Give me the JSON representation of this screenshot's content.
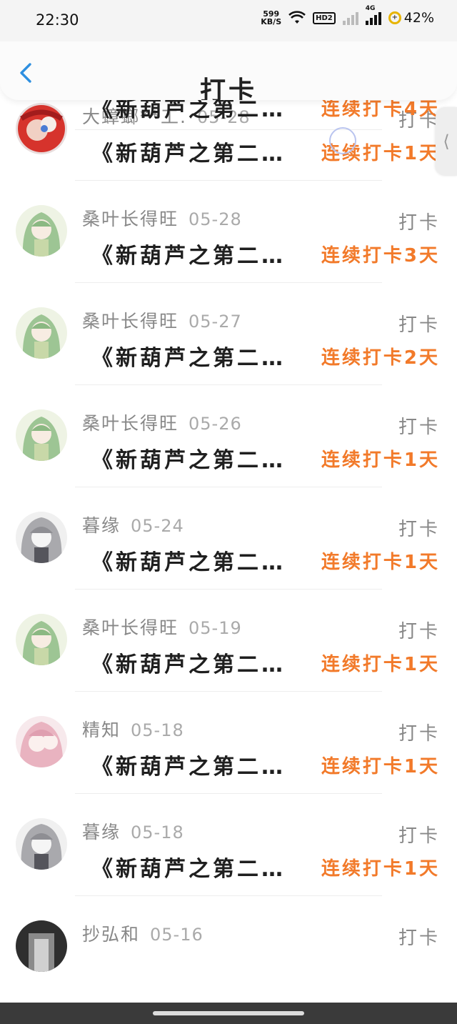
{
  "status_bar": {
    "time": "22:30",
    "net_speed_value": "599",
    "net_speed_unit": "KB/S",
    "hd_label": "HD2",
    "network_label": "4G",
    "battery": "42%",
    "icons": [
      "wifi-icon",
      "signal-icon",
      "battery-icon"
    ]
  },
  "header": {
    "title": "打卡",
    "back_icon": "chevron-left-icon"
  },
  "partial_row": {
    "book": "《新葫芦之第二…",
    "streak": "连续打卡4天"
  },
  "rows": [
    {
      "name": "大蟑螂**工.",
      "date": "05-28",
      "action": "打卡",
      "book": "《新葫芦之第二…",
      "streak": "连续打卡1天"
    },
    {
      "name": "桑叶长得旺",
      "date": "05-28",
      "action": "打卡",
      "book": "《新葫芦之第二…",
      "streak": "连续打卡3天"
    },
    {
      "name": "桑叶长得旺",
      "date": "05-27",
      "action": "打卡",
      "book": "《新葫芦之第二…",
      "streak": "连续打卡2天"
    },
    {
      "name": "桑叶长得旺",
      "date": "05-26",
      "action": "打卡",
      "book": "《新葫芦之第二…",
      "streak": "连续打卡1天"
    },
    {
      "name": "暮缘",
      "date": "05-24",
      "action": "打卡",
      "book": "《新葫芦之第二…",
      "streak": "连续打卡1天"
    },
    {
      "name": "桑叶长得旺",
      "date": "05-19",
      "action": "打卡",
      "book": "《新葫芦之第二…",
      "streak": "连续打卡1天"
    },
    {
      "name": "精知",
      "date": "05-18",
      "action": "打卡",
      "book": "《新葫芦之第二…",
      "streak": "连续打卡1天"
    },
    {
      "name": "暮缘",
      "date": "05-18",
      "action": "打卡",
      "book": "《新葫芦之第二…",
      "streak": "连续打卡1天"
    },
    {
      "name": "抄弘和",
      "date": "05-16",
      "action": "打卡",
      "book": "",
      "streak": ""
    }
  ],
  "side_tab_glyph": "⟨",
  "colors": {
    "accent_orange": "#f27a2a",
    "back_blue": "#2e8fe0",
    "muted_text": "#888888"
  }
}
